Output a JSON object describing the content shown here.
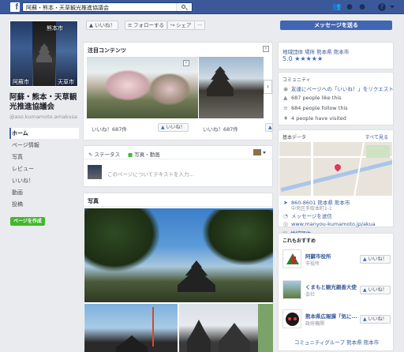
{
  "topbar": {
    "search_value": "阿蘇・熊本・天草観光推進協議会",
    "icons": [
      "friends-icon",
      "messages-icon",
      "globe-icon",
      "help-icon"
    ]
  },
  "profile": {
    "photo_labels": {
      "top_right": "熊本市",
      "bottom_left": "阿蘇市",
      "bottom_right": "天草市"
    },
    "page_name": "阿蘇・熊本・天草観光推進協議会",
    "handle": "@aso.kumamoto.amakusa"
  },
  "nav": {
    "items": [
      "ホーム",
      "ページ情報",
      "写真",
      "レビュー",
      "いいね！",
      "動画",
      "投稿"
    ],
    "create_page": "ページを作成"
  },
  "actions": {
    "like": "いいね！",
    "follow": "フォローする",
    "share": "シェア",
    "more": "···",
    "message": "メッセージを送る"
  },
  "featured": {
    "title": "注目コンテンツ",
    "items": [
      {
        "likes": "いいね！687件",
        "like_button": "いいね！"
      },
      {
        "likes": "いいね！687件",
        "like_button": "いいね！"
      }
    ]
  },
  "composer": {
    "status_tab": "ステータス",
    "photo_tab": "写真・動画",
    "placeholder": "このページについてテキストを入力..."
  },
  "photos": {
    "title": "写真"
  },
  "about": {
    "categories": "地域団体 場所 熊本県 熊本市",
    "rating": "5.0 ★★★★★"
  },
  "community": {
    "title": "コミュニティ",
    "invite": "友達にページへの「いいね！」をリクエスト",
    "likes": "687 people like this",
    "follows": "684 people follow this",
    "visits": "4 people have visited"
  },
  "basic": {
    "title": "基本データ",
    "see_all": "すべて見る",
    "address": "860-8601 熊本県 熊本市",
    "address2": "中央区手取本町1-1",
    "send_message": "メッセージを送信",
    "website": "www.manyou-kumamoto.jp/akua",
    "category": "地域団体"
  },
  "recommend": {
    "title": "これもおすすめ",
    "items": [
      {
        "name": "阿蘇市役所",
        "cat": "市役所",
        "like": "いいね！"
      },
      {
        "name": "くまもと観光親善大使",
        "cat": "会社",
        "like": "いいね！"
      },
      {
        "name": "熊本県広報課「気に...",
        "cat": "政府機関",
        "like": "いいね！"
      }
    ],
    "footer": "コミュニティグループ 熊本県 熊本市"
  }
}
